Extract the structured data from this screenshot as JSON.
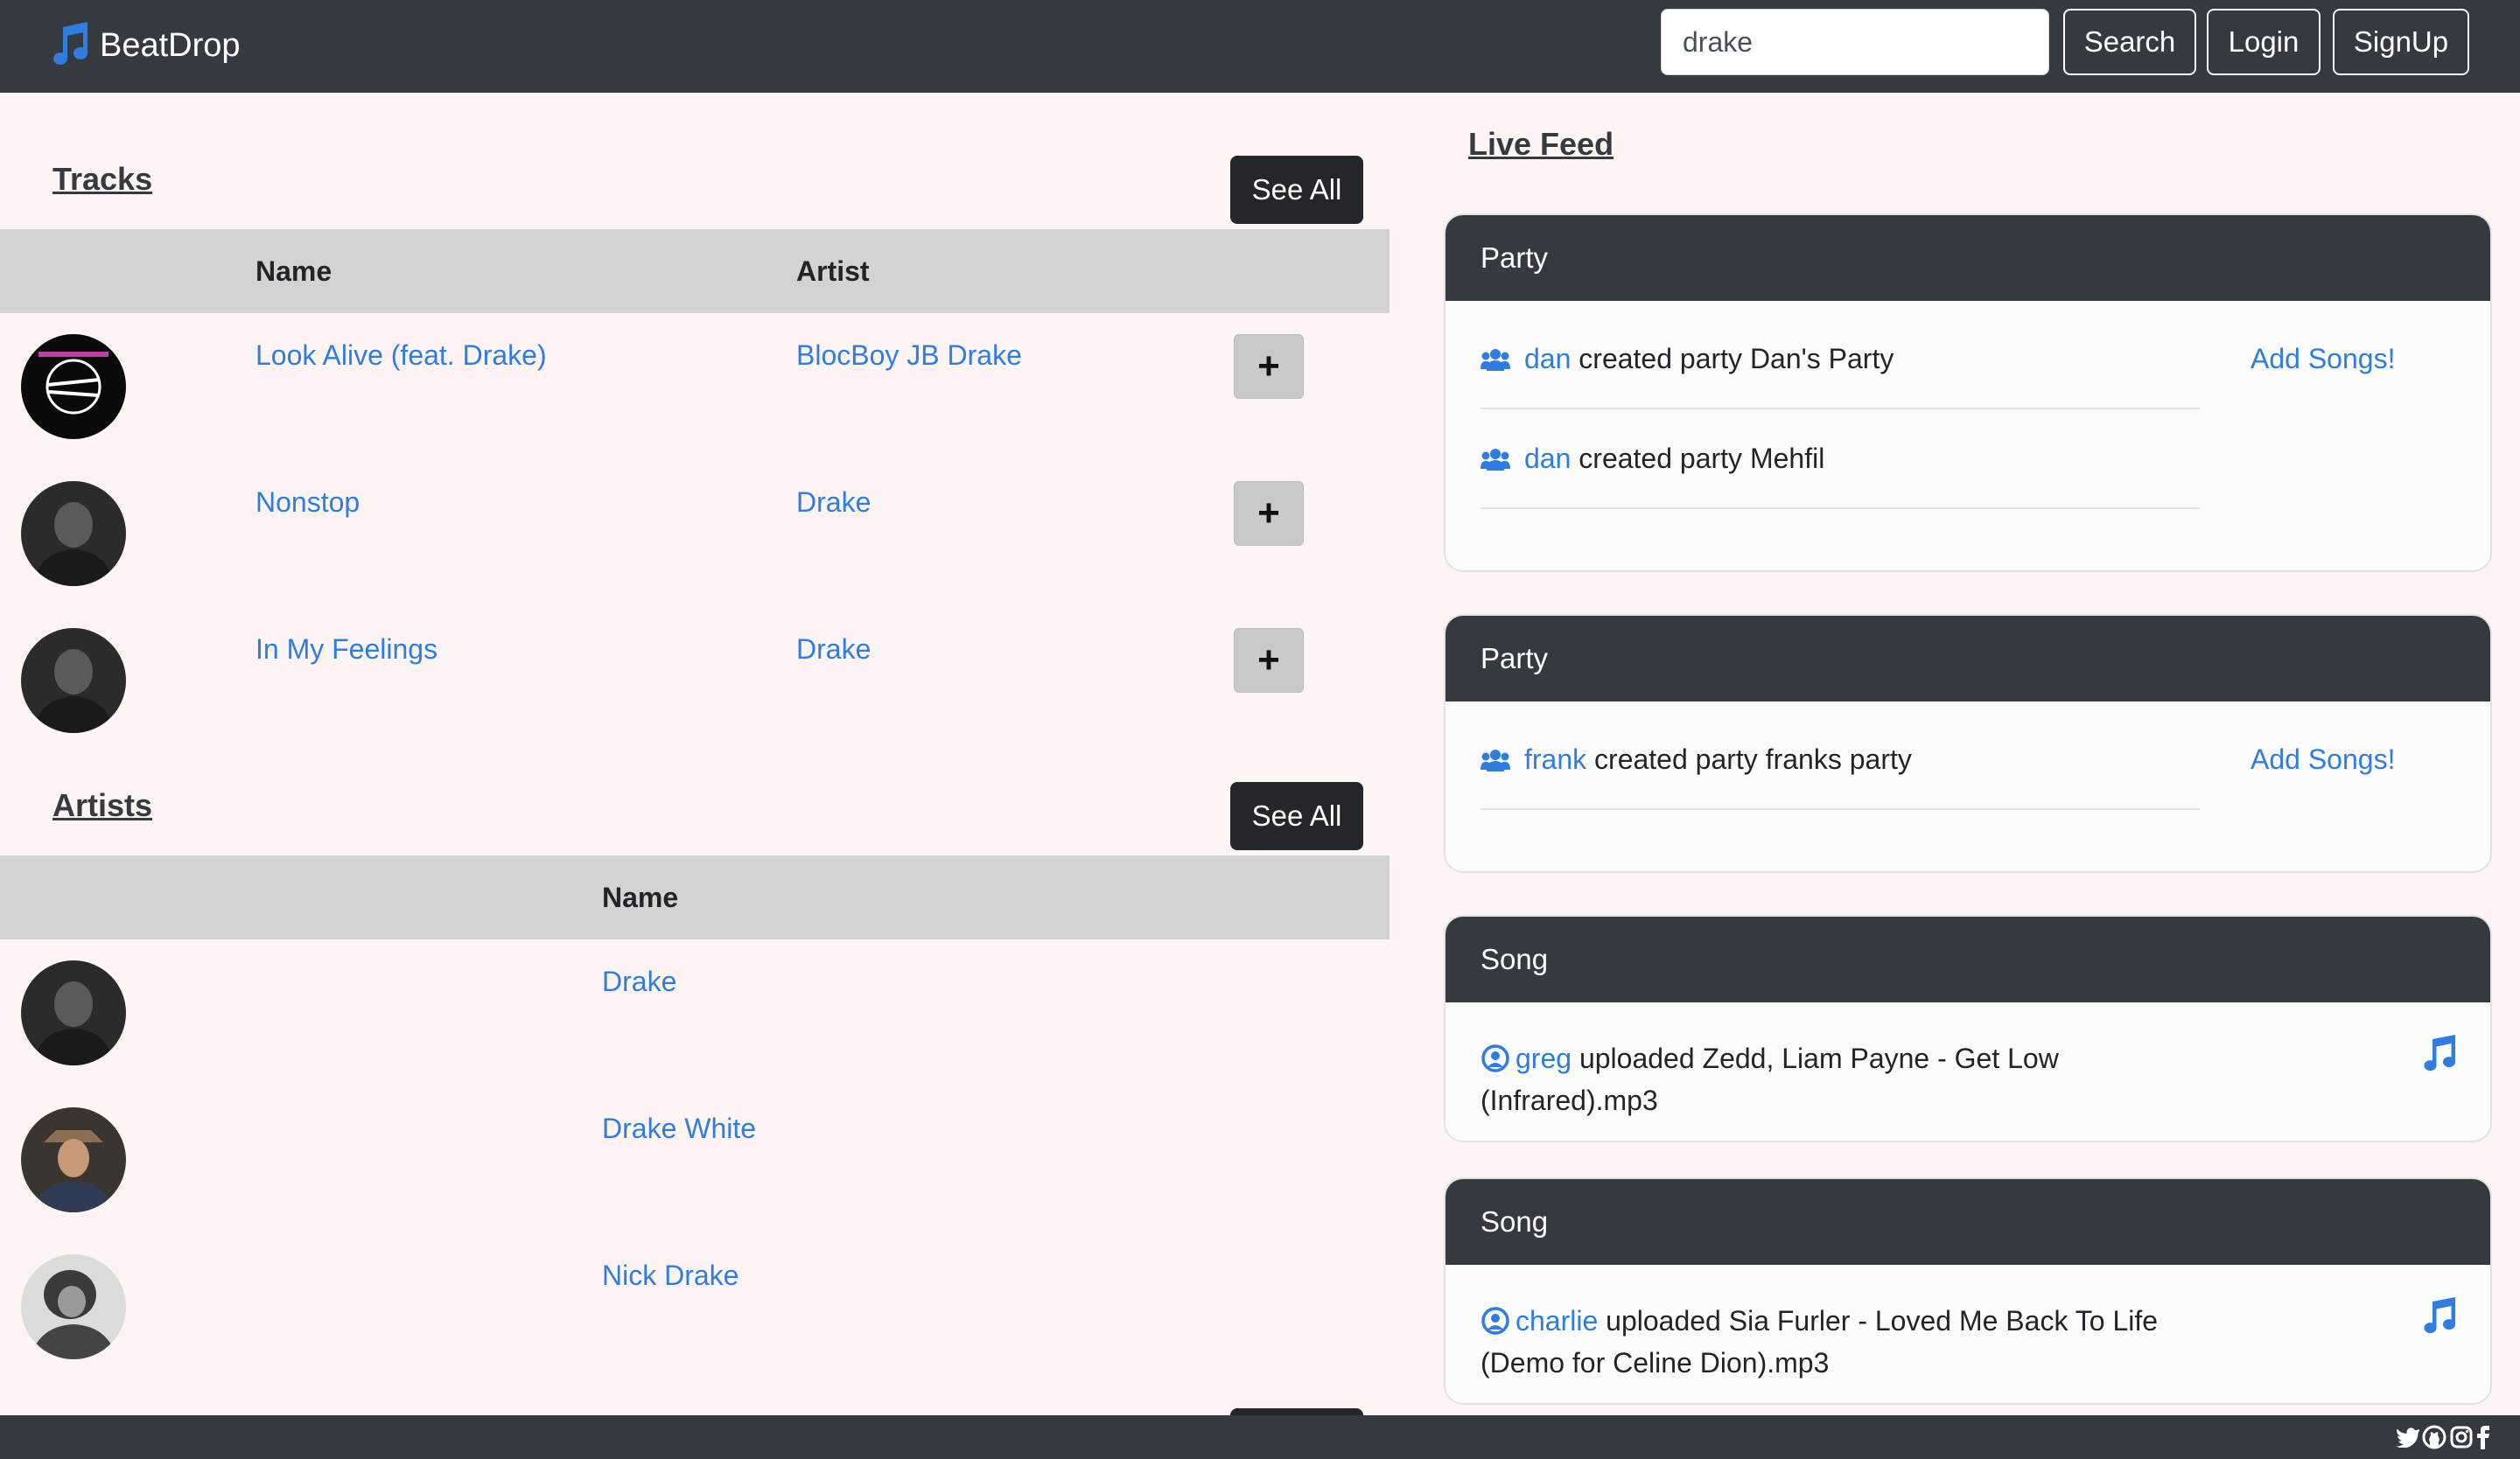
{
  "app": {
    "name": "BeatDrop",
    "brand_color": "#2f7de1"
  },
  "nav": {
    "search_value": "drake",
    "search_placeholder": "",
    "search_label": "Search",
    "login_label": "Login",
    "signup_label": "SignUp"
  },
  "tracks": {
    "title": "Tracks",
    "see_all": "See All",
    "headers": {
      "name": "Name",
      "artist": "Artist"
    },
    "rows": [
      {
        "name": "Look Alive (feat. Drake)",
        "artist": "BlocBoy JB Drake",
        "add": "+"
      },
      {
        "name": "Nonstop",
        "artist": "Drake",
        "add": "+"
      },
      {
        "name": "In My Feelings",
        "artist": "Drake",
        "add": "+"
      }
    ]
  },
  "artists": {
    "title": "Artists",
    "see_all": "See All",
    "headers": {
      "name": "Name"
    },
    "rows": [
      {
        "name": "Drake"
      },
      {
        "name": "Drake White"
      },
      {
        "name": "Nick Drake"
      }
    ]
  },
  "feed": {
    "title": "Live Feed",
    "cards": [
      {
        "type": "Party",
        "items": [
          {
            "user": "dan",
            "text": "created party Dan's Party",
            "action": "Add Songs!"
          },
          {
            "user": "dan",
            "text": "created party Mehfil"
          }
        ]
      },
      {
        "type": "Party",
        "items": [
          {
            "user": "frank",
            "text": "created party franks party",
            "action": "Add Songs!"
          }
        ]
      },
      {
        "type": "Song",
        "items": [
          {
            "user": "greg",
            "text_line1": "uploaded Zedd, Liam Payne - Get Low",
            "text_line2": "(Infrared).mp3"
          }
        ]
      },
      {
        "type": "Song",
        "items": [
          {
            "user": "charlie",
            "text_line1": "uploaded Sia Furler - Loved Me Back To Life",
            "text_line2": "(Demo for Celine Dion).mp3"
          }
        ]
      }
    ]
  },
  "footer": {
    "icons": [
      "twitter-icon",
      "github-icon",
      "instagram-icon",
      "facebook-icon"
    ]
  }
}
